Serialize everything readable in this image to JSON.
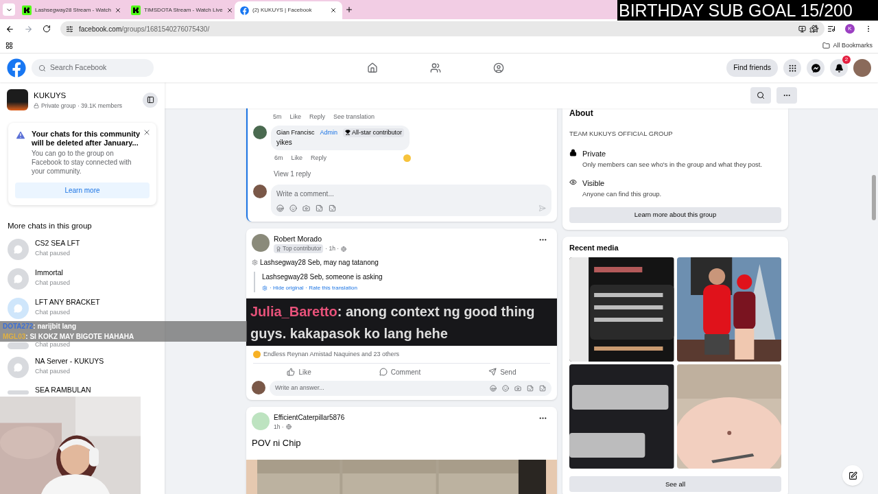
{
  "overlay_goal": "BIRTHDAY SUB GOAL 15/200",
  "browser": {
    "tabs": [
      {
        "title": "Lashsegway28 Stream - Watch",
        "selected": false,
        "kind": "kick"
      },
      {
        "title": "TIMSDOTA Stream - Watch Live",
        "selected": false,
        "kind": "kick"
      },
      {
        "title": "(2) KUKUYS | Facebook",
        "selected": true,
        "kind": "facebook"
      }
    ],
    "url_host": "facebook.com",
    "url_path": "/groups/1681540276075430/",
    "profile_initial": "K",
    "bookmarks": "All Bookmarks"
  },
  "header": {
    "search_placeholder": "Search Facebook",
    "find_friends": "Find friends",
    "notifications": "2"
  },
  "group": {
    "name": "KUKUYS",
    "meta": "Private group · 39.1K members"
  },
  "notice": {
    "title": "Your chats for this community will be deleted after January...",
    "body": "You can go to the group on Facebook to stay connected with your community.",
    "button": "Learn more"
  },
  "chats": {
    "heading": "More chats in this group",
    "items": [
      {
        "name": "CS2 SEA LFT",
        "status": "Chat paused",
        "color": "#d8dade"
      },
      {
        "name": "Immortal",
        "status": "Chat paused",
        "color": "#d8dade"
      },
      {
        "name": "LFT ANY BRACKET",
        "status": "Chat paused",
        "color": "#cfe6fb"
      },
      {
        "status": "Chat paused",
        "color": "#d8dade"
      },
      {
        "name": "NA Server - KUKUYS",
        "status": "Chat paused",
        "color": "#d8dade"
      },
      {
        "name": "SEA RAMBULAN",
        "color": "#d8dade"
      }
    ]
  },
  "stream_chat": [
    {
      "user": "DOTA272",
      "message": ": narijbit lang",
      "color": "#3b6fd6"
    },
    {
      "user": "MGL03",
      "message": ": SI KOKZ MAY BIGOTE HAHAHA",
      "color": "#e0b040"
    }
  ],
  "thread": {
    "meta": [
      "5m",
      "Like",
      "Reply",
      "See translation"
    ],
    "comment": {
      "author": "Gian Francisc",
      "role": "Admin",
      "badge": "All-star contributor",
      "text": "yikes",
      "meta": [
        "6m",
        "Like",
        "Reply"
      ]
    },
    "view_replies": "View 1 reply",
    "comment_placeholder": "Write a comment..."
  },
  "post": {
    "author": "Robert Morado",
    "badge": "Top contributor",
    "time": "· 1h ·",
    "text": "Lashsegway28 Seb, may nag tatanong",
    "translation": "Lashsegway28 Seb, someone is asking",
    "translation_links": [
      "· Hide original",
      "· Rate this translation"
    ],
    "image_user": "Julia_Baretto",
    "image_text": ": anong context ng good thing guys. kakapasok ko lang hehe",
    "reactions": "Endless Reynan Amistad Naquines and 23 others",
    "actions": [
      {
        "kind": "like",
        "label": "Like"
      },
      {
        "kind": "comment",
        "label": "Comment"
      },
      {
        "kind": "send",
        "label": "Send"
      }
    ],
    "answer_placeholder": "Write an answer..."
  },
  "post2": {
    "author": "EfficientCaterpillar5876",
    "time": "1h ·",
    "text": "POV ni Chip"
  },
  "about": {
    "heading": "About",
    "description": "TEAM KUKUYS OFFICIAL GROUP",
    "items": [
      {
        "kind": "private",
        "title": "Private",
        "text": "Only members can see who's in the group and what they post."
      },
      {
        "kind": "visible",
        "title": "Visible",
        "text": "Anyone can find this group."
      }
    ],
    "button": "Learn more about this group"
  },
  "media": {
    "heading": "Recent media",
    "button": "See all"
  }
}
